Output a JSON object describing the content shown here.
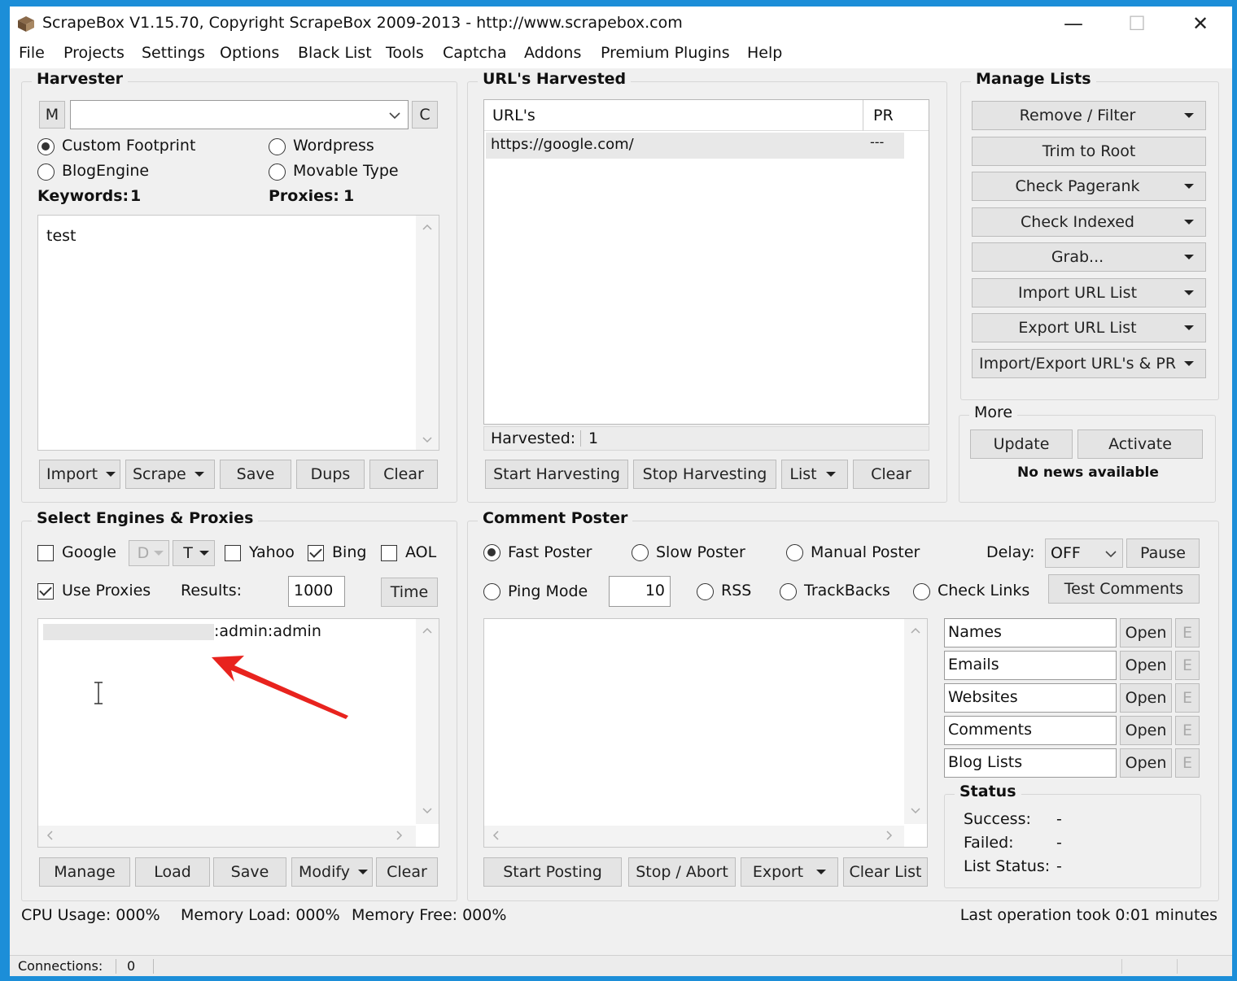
{
  "window": {
    "title": "ScrapeBox V1.15.70, Copyright ScrapeBox 2009-2013 - http://www.scrapebox.com",
    "minimize": "—",
    "maximize": "☐",
    "close": "✕"
  },
  "menu": [
    "File",
    "Projects",
    "Settings",
    "Options",
    "Black List",
    "Tools",
    "Captcha",
    "Addons",
    "Premium Plugins",
    "Help"
  ],
  "harvester": {
    "title": "Harvester",
    "m_button": "M",
    "c_button": "C",
    "footprint_value": "",
    "radios": [
      "Custom Footprint",
      "Wordpress",
      "BlogEngine",
      "Movable Type"
    ],
    "selected_radio": "Custom Footprint",
    "keywords_label": "Keywords:",
    "keywords_count": "1",
    "proxies_label": "Proxies:",
    "proxies_count": "1",
    "keywords_text": "test",
    "buttons": {
      "import": "Import",
      "scrape": "Scrape",
      "save": "Save",
      "dups": "Dups",
      "clear": "Clear"
    }
  },
  "urls": {
    "title": "URL's Harvested",
    "col_url": "URL's",
    "col_pr": "PR",
    "rows": [
      {
        "url": "https://google.com/",
        "pr": "---"
      }
    ],
    "harvested_label": "Harvested:",
    "harvested_count": "1",
    "buttons": {
      "start": "Start Harvesting",
      "stop": "Stop Harvesting",
      "list": "List",
      "clear": "Clear"
    }
  },
  "manage": {
    "title": "Manage Lists",
    "buttons": [
      "Remove / Filter",
      "Trim to Root",
      "Check Pagerank",
      "Check Indexed",
      "Grab...",
      "Import URL List",
      "Export URL List",
      "Import/Export URL's & PR"
    ]
  },
  "more": {
    "title": "More",
    "update": "Update",
    "activate": "Activate",
    "news": "No news available"
  },
  "engines": {
    "title": "Select Engines & Proxies",
    "google": "Google",
    "google_checked": false,
    "d_label": "D",
    "t_label": "T",
    "yahoo": "Yahoo",
    "yahoo_checked": false,
    "bing": "Bing",
    "bing_checked": true,
    "aol": "AOL",
    "aol_checked": false,
    "use_proxies": "Use Proxies",
    "use_proxies_checked": true,
    "results_label": "Results:",
    "results_value": "1000",
    "time_button": "Time",
    "proxy_line": ":admin:admin",
    "buttons": {
      "manage": "Manage",
      "load": "Load",
      "save": "Save",
      "modify": "Modify",
      "clear": "Clear"
    }
  },
  "poster": {
    "title": "Comment Poster",
    "radios": [
      "Fast Poster",
      "Slow Poster",
      "Manual Poster",
      "Ping Mode",
      "RSS",
      "TrackBacks",
      "Check Links"
    ],
    "selected": "Fast Poster",
    "delay_label": "Delay:",
    "delay_value": "OFF",
    "pause": "Pause",
    "ping_value": "10",
    "test_comments": "Test Comments",
    "files": [
      {
        "name": "Names",
        "open": "Open",
        "e": "E"
      },
      {
        "name": "Emails",
        "open": "Open",
        "e": "E"
      },
      {
        "name": "Websites",
        "open": "Open",
        "e": "E"
      },
      {
        "name": "Comments",
        "open": "Open",
        "e": "E"
      },
      {
        "name": "Blog Lists",
        "open": "Open",
        "e": "E"
      }
    ],
    "status": {
      "title": "Status",
      "success_label": "Success:",
      "success_value": "-",
      "failed_label": "Failed:",
      "failed_value": "-",
      "list_label": "List Status:",
      "list_value": "-"
    },
    "buttons": {
      "start": "Start Posting",
      "stop": "Stop / Abort",
      "export": "Export",
      "clear": "Clear List"
    }
  },
  "statusline": {
    "cpu": "CPU Usage: 000%",
    "mem_load": "Memory Load: 000%",
    "mem_free": "Memory Free: 000%",
    "last_op": "Last operation took 0:01 minutes"
  },
  "statusbar": {
    "connections_label": "Connections:",
    "connections_value": "0"
  },
  "colors": {
    "annotation_arrow": "#e8231e",
    "title_bg": "#ffffff",
    "window_bg": "#f0f0f0",
    "desktop": "#1c8ed8"
  }
}
